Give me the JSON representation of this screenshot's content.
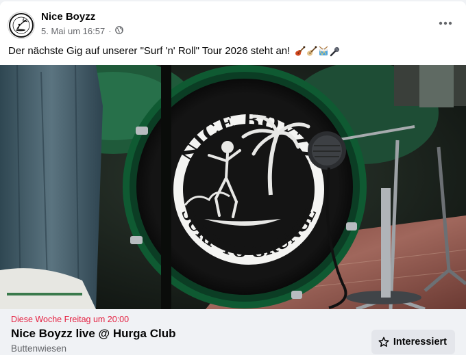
{
  "post": {
    "page_name": "Nice Boyzz",
    "timestamp": "5. Mai um 16:57",
    "separator": "·",
    "audience_icon": "globe-icon",
    "text": "Der nächste Gig auf unserer \"Surf 'n' Roll\" Tour 2026 steht an!",
    "emojis": [
      "guitar-emoji",
      "guitar-emoji",
      "drum-emoji",
      "microphone-emoji"
    ],
    "more_icon": "more-horizontal-icon"
  },
  "avatar": {
    "top_text": "NICE BOYZZ",
    "bottom_text": "SURF TO GRUNGE"
  },
  "photo": {
    "drum_head_top": "NICE BOYZZ",
    "drum_head_bottom": "SURF TO GRUNGE"
  },
  "event": {
    "date_line": "Diese Woche Freitag um 20:00",
    "title": "Nice Boyzz live @ Hurga Club",
    "location": "Buttenwiesen",
    "interest_label": "Interessiert",
    "interest_icon": "star-icon"
  },
  "colors": {
    "date_red": "#e41e3f",
    "secondary_text": "#65676b",
    "button_bg": "#e4e6eb",
    "bar_bg": "#f0f2f5"
  }
}
